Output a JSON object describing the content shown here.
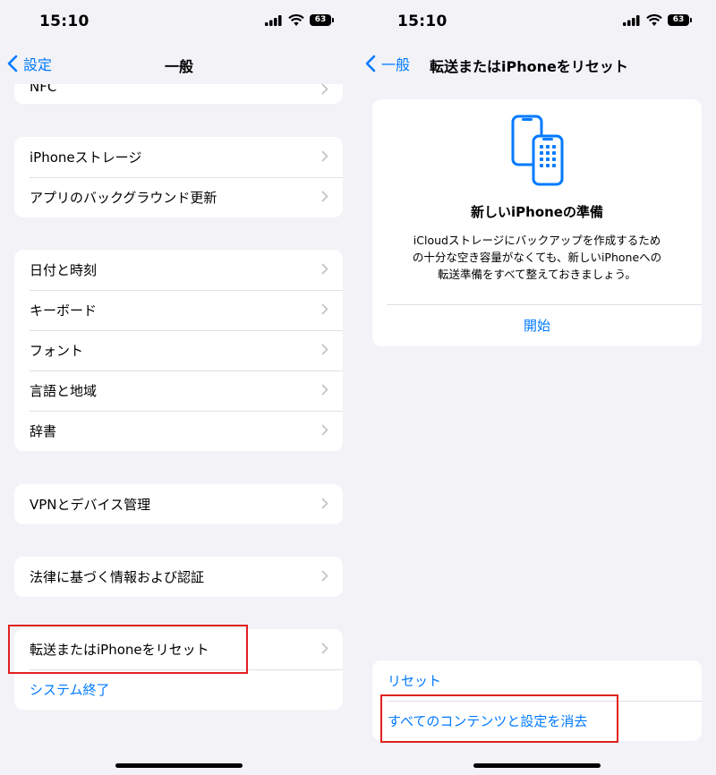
{
  "status": {
    "time": "15:10",
    "battery": "63"
  },
  "left": {
    "nav": {
      "back_label": "設定",
      "title": "一般"
    },
    "partial_item": "NFC",
    "group1": [
      "iPhoneストレージ",
      "アプリのバックグラウンド更新"
    ],
    "group2": [
      "日付と時刻",
      "キーボード",
      "フォント",
      "言語と地域",
      "辞書"
    ],
    "group3": [
      "VPNとデバイス管理"
    ],
    "group4": [
      "法律に基づく情報および認証"
    ],
    "group5": {
      "transfer_reset": "転送またはiPhoneをリセット",
      "shutdown": "システム終了"
    }
  },
  "right": {
    "nav": {
      "back_label": "一般",
      "title": "転送またはiPhoneをリセット"
    },
    "card": {
      "title": "新しいiPhoneの準備",
      "desc_line1": "iCloudストレージにバックアップを作成するため",
      "desc_line2": "の十分な空き容量がなくても、新しいiPhoneへの",
      "desc_line3": "転送準備をすべて整えておきましょう。",
      "button": "開始"
    },
    "actions": {
      "reset": "リセット",
      "erase": "すべてのコンテンツと設定を消去"
    }
  },
  "colors": {
    "accent": "#007aff",
    "highlight": "#e02020",
    "background": "#f2f2f7"
  },
  "icons": [
    "chevron-left-icon",
    "chevron-right-icon",
    "signal-icon",
    "wifi-icon",
    "battery-icon",
    "phone-transfer-icon"
  ]
}
